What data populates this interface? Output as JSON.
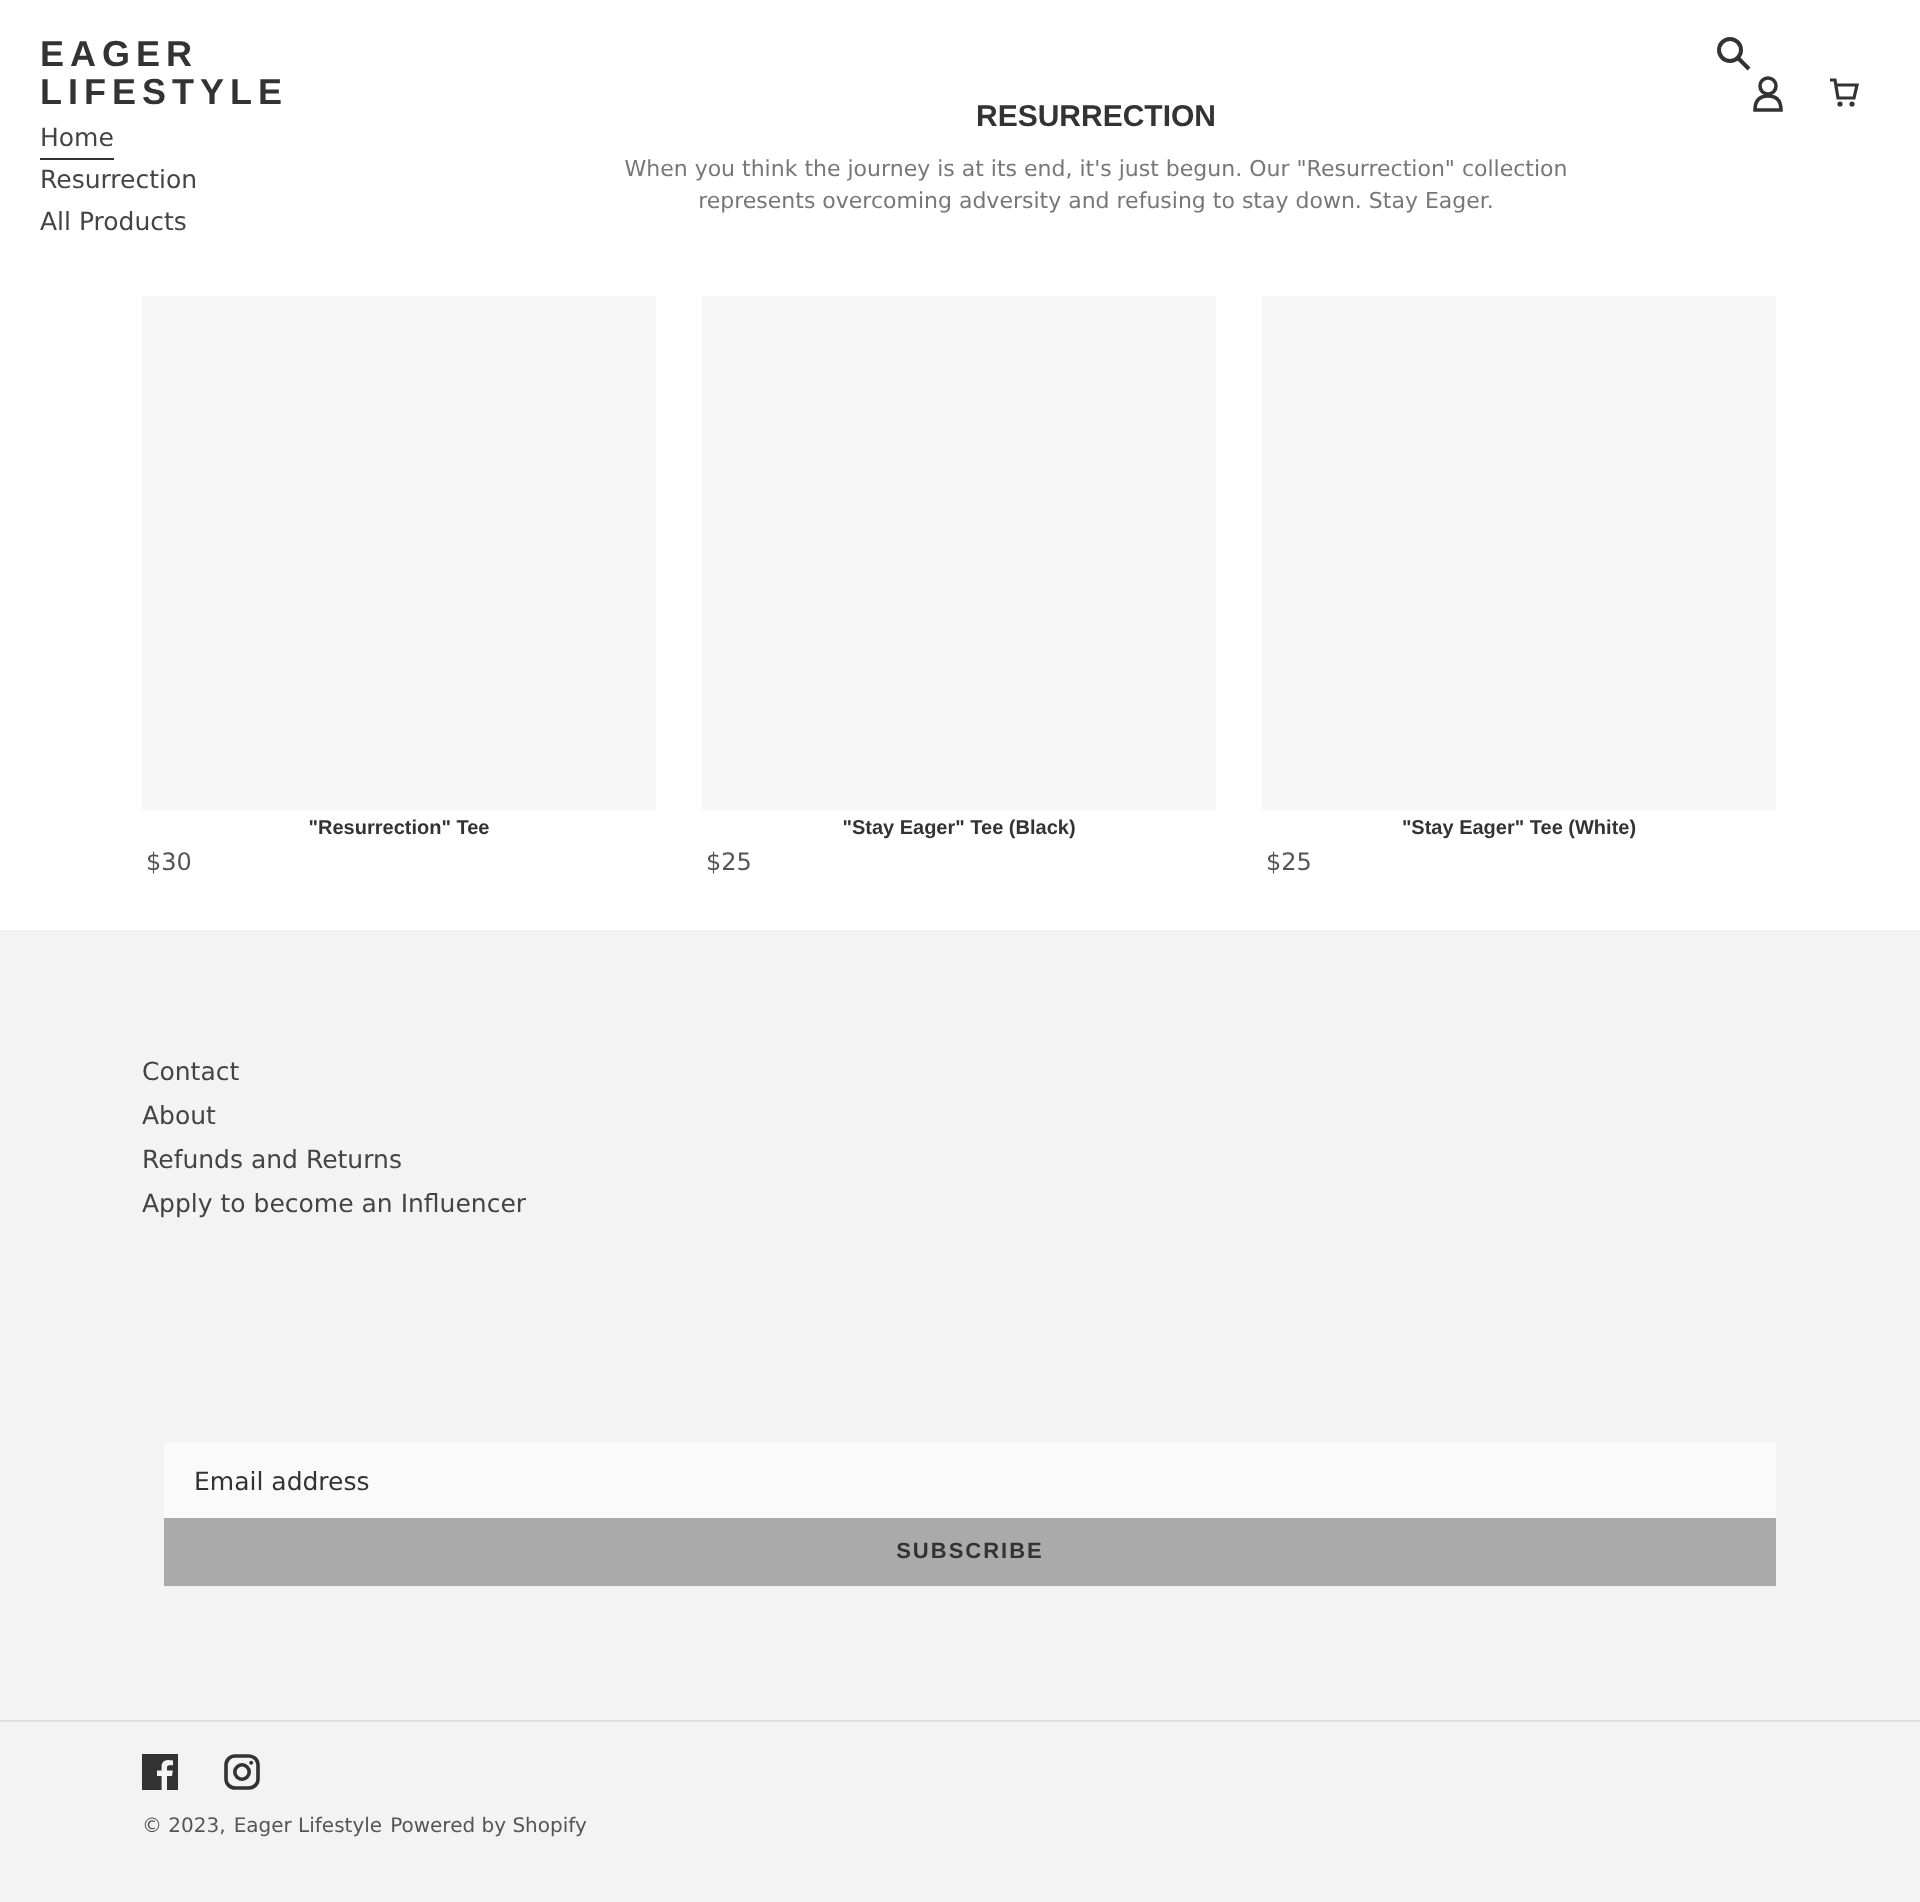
{
  "header": {
    "logo": "EAGER LIFESTYLE"
  },
  "nav": [
    {
      "label": "Home",
      "selected": true
    },
    {
      "label": "Resurrection",
      "selected": false
    },
    {
      "label": "All Products",
      "selected": false
    }
  ],
  "collection": {
    "title": "RESURRECTION",
    "description": "When you think the journey is at its end, it's just begun. Our \"Resurrection\" collection represents overcoming adversity and refusing to stay down. Stay Eager."
  },
  "products": [
    {
      "title": "\"Resurrection\" Tee",
      "price": "$30"
    },
    {
      "title": "\"Stay Eager\" Tee (Black)",
      "price": "$25"
    },
    {
      "title": "\"Stay Eager\" Tee (White)",
      "price": "$25"
    }
  ],
  "footer": {
    "links": [
      "Contact",
      "About",
      "Refunds and Returns",
      "Apply to become an Influencer"
    ],
    "newsletter": {
      "placeholder": "Email address",
      "button": "SUBSCRIBE"
    },
    "copyright": "© 2023,",
    "store_link": "Eager Lifestyle",
    "powered_by": "Powered by Shopify"
  }
}
